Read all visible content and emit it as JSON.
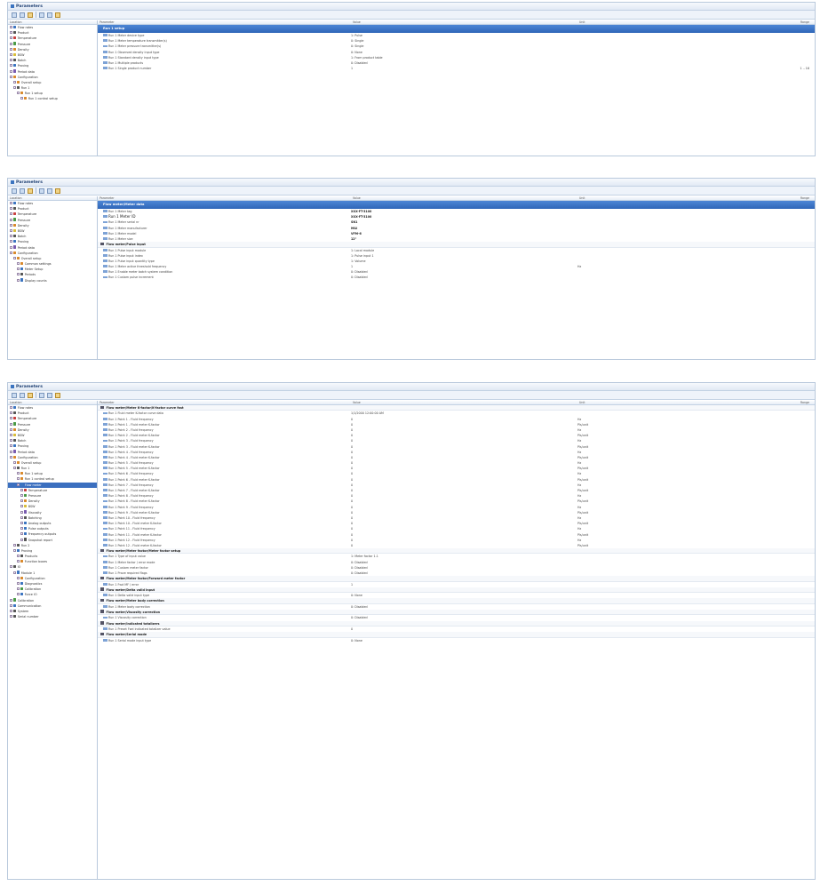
{
  "panel1": {
    "title": "Parameters",
    "tree_header": "Location",
    "columns": {
      "parameter": "Parameter",
      "value": "Value",
      "unit": "Unit",
      "range": "Range"
    },
    "section": "Run 1 setup",
    "tree": [
      {
        "label": "Flow rates",
        "icon": "ic-b"
      },
      {
        "label": "Product",
        "icon": "ic-k"
      },
      {
        "label": "Temperature",
        "icon": "ic-r"
      },
      {
        "label": "Pressure",
        "icon": "ic-g"
      },
      {
        "label": "Density",
        "icon": "ic-o"
      },
      {
        "label": "BSW",
        "icon": "ic-y"
      },
      {
        "label": "Batch",
        "icon": "ic-k"
      },
      {
        "label": "Proving",
        "icon": "ic-b"
      },
      {
        "label": "Period data",
        "icon": "ic-p"
      },
      {
        "label": "Configuration",
        "icon": "ic-o"
      },
      {
        "label": "Overall setup",
        "icon": "ic-o"
      },
      {
        "label": "Run 1",
        "icon": "ic-k"
      },
      {
        "label": "Run 1 setup",
        "icon": "ic-o"
      },
      {
        "label": "Run 1 control setup",
        "icon": "ic-o"
      }
    ],
    "rows": [
      {
        "p": "Run 1 Meter device type",
        "v": "1: Pulse",
        "u": "",
        "r": ""
      },
      {
        "p": "Run 1 Meter temperature transmitter(s)",
        "v": "0: Single",
        "u": "",
        "r": ""
      },
      {
        "p": "Run 1 Meter pressure transmitter(s)",
        "v": "0: Single",
        "u": "",
        "r": ""
      },
      {
        "p": "Run 1 Observed density input type",
        "v": "0: None",
        "u": "",
        "r": ""
      },
      {
        "p": "Run 1 Standard density input type",
        "v": "1: From product table",
        "u": "",
        "r": ""
      },
      {
        "p": "Run 1 Multiple products",
        "v": "0: Disabled",
        "u": "",
        "r": ""
      },
      {
        "p": "Run 1 Single product number",
        "v": "1",
        "u": "",
        "r": "1 .. 16"
      }
    ]
  },
  "panel2": {
    "title": "Parameters",
    "tree_header": "Location",
    "columns": {
      "parameter": "Parameter",
      "value": "Value",
      "unit": "Unit",
      "range": "Range"
    },
    "section": "Flow meter/Meter data",
    "tree": [
      {
        "label": "Flow rates",
        "icon": "ic-b"
      },
      {
        "label": "Product",
        "icon": "ic-k"
      },
      {
        "label": "Temperature",
        "icon": "ic-r"
      },
      {
        "label": "Pressure",
        "icon": "ic-g"
      },
      {
        "label": "Density",
        "icon": "ic-o"
      },
      {
        "label": "BSW",
        "icon": "ic-y"
      },
      {
        "label": "Batch",
        "icon": "ic-k"
      },
      {
        "label": "Proving",
        "icon": "ic-b"
      },
      {
        "label": "Period data",
        "icon": "ic-p"
      },
      {
        "label": "Configuration",
        "icon": "ic-o"
      },
      {
        "label": "Overall setup",
        "icon": "ic-o"
      },
      {
        "label": "Common settings",
        "icon": "ic-o"
      },
      {
        "label": "Meter Setup",
        "icon": "ic-b"
      },
      {
        "label": "Periods",
        "icon": "ic-k"
      },
      {
        "label": "Display counts",
        "icon": "ic-b"
      }
    ],
    "rows_a": [
      {
        "p": "Run 1 Meter tag",
        "v": "XXX-FT-3100",
        "u": "",
        "r": "",
        "big": false,
        "bold": true
      },
      {
        "p": "Run 1 Meter ID",
        "v": "XXX-FT-3100",
        "u": "",
        "r": "",
        "big": true,
        "bold": true
      },
      {
        "p": "Run 1 Meter serial nr",
        "v": "SN1",
        "u": "",
        "r": "",
        "big": false,
        "bold": true
      },
      {
        "p": "Run 1 Meter manufacturer",
        "v": "M&I",
        "u": "",
        "r": "",
        "big": false,
        "bold": true
      },
      {
        "p": "Run 1 Meter model",
        "v": "VFM-6",
        "u": "",
        "r": "",
        "big": false,
        "bold": true
      },
      {
        "p": "Run 1 Meter size",
        "v": "12\"",
        "u": "",
        "r": "",
        "big": false,
        "bold": true
      }
    ],
    "section2": "Flow meter/Pulse input",
    "rows_b": [
      {
        "p": "Run 1 Pulse input module",
        "v": "1: Local module",
        "u": "",
        "r": ""
      },
      {
        "p": "Run 1 Pulse input index",
        "v": "1: Pulse input 1",
        "u": "",
        "r": ""
      },
      {
        "p": "Run 1 Pulse input quantity type",
        "v": "1: Volume",
        "u": "",
        "r": ""
      },
      {
        "p": "Run 1 Meter active threshold frequency",
        "v": "1",
        "u": "Hz",
        "r": ""
      },
      {
        "p": "Run 1 Enable meter batch system condition",
        "v": "0: Disabled",
        "u": "",
        "r": ""
      },
      {
        "p": "Run 1 Custom pulse increment",
        "v": "0: Disabled",
        "u": "",
        "r": ""
      }
    ]
  },
  "panel3": {
    "title": "Parameters",
    "tree_header": "Location",
    "columns": {
      "parameter": "Parameter",
      "value": "Value",
      "unit": "Unit",
      "range": "Range"
    },
    "tree": [
      {
        "label": "Flow rates",
        "icon": "ic-b"
      },
      {
        "label": "Product",
        "icon": "ic-k"
      },
      {
        "label": "Temperature",
        "icon": "ic-r"
      },
      {
        "label": "Pressure",
        "icon": "ic-g"
      },
      {
        "label": "Density",
        "icon": "ic-o"
      },
      {
        "label": "BSW",
        "icon": "ic-y"
      },
      {
        "label": "Batch",
        "icon": "ic-k"
      },
      {
        "label": "Proving",
        "icon": "ic-b"
      },
      {
        "label": "Period data",
        "icon": "ic-p"
      },
      {
        "label": "Configuration",
        "icon": "ic-o"
      },
      {
        "label": "Overall setup",
        "icon": "ic-o"
      },
      {
        "label": "Run 1",
        "icon": "ic-k"
      },
      {
        "label": "Run 1 setup",
        "icon": "ic-o"
      },
      {
        "label": "Run 1 control setup",
        "icon": "ic-o"
      },
      {
        "label": "Flow meter",
        "icon": "ic-b",
        "selected": true
      },
      {
        "label": "Temperature",
        "icon": "ic-r"
      },
      {
        "label": "Pressure",
        "icon": "ic-g"
      },
      {
        "label": "Density",
        "icon": "ic-o"
      },
      {
        "label": "BSW",
        "icon": "ic-y"
      },
      {
        "label": "Viscosity",
        "icon": "ic-p"
      },
      {
        "label": "Batching",
        "icon": "ic-k"
      },
      {
        "label": "Analog outputs",
        "icon": "ic-b"
      },
      {
        "label": "Pulse outputs",
        "icon": "ic-b"
      },
      {
        "label": "Frequency outputs",
        "icon": "ic-b"
      },
      {
        "label": "Snapshot report",
        "icon": "ic-k"
      },
      {
        "label": "Run 2",
        "icon": "ic-k"
      },
      {
        "label": "Proving",
        "icon": "ic-b"
      },
      {
        "label": "Products",
        "icon": "ic-k"
      },
      {
        "label": "Function boxes",
        "icon": "ic-o"
      },
      {
        "label": "IO",
        "icon": "ic-k"
      },
      {
        "label": "Module 1",
        "icon": "ic-b"
      },
      {
        "label": "Configuration",
        "icon": "ic-o"
      },
      {
        "label": "Diagnostics",
        "icon": "ic-b"
      },
      {
        "label": "Calibration",
        "icon": "ic-g"
      },
      {
        "label": "Force IO",
        "icon": "ic-b"
      },
      {
        "label": "Calibration",
        "icon": "ic-g"
      },
      {
        "label": "Communication",
        "icon": "ic-b"
      },
      {
        "label": "System",
        "icon": "ic-k"
      },
      {
        "label": "Serial number",
        "icon": "ic-k"
      }
    ],
    "sec_kfactor": "Flow meter/Meter K-factor/K-factor curve fast",
    "kf_first": {
      "p": "Run 1 Fluid meter K-factor curve data",
      "v": "1/1/2000 12:00:00 AM",
      "u": "",
      "r": ""
    },
    "kf_points": [
      {
        "n": "1"
      },
      {
        "n": "2"
      },
      {
        "n": "3"
      },
      {
        "n": "4"
      },
      {
        "n": "5"
      },
      {
        "n": "6"
      },
      {
        "n": "7"
      },
      {
        "n": "8"
      },
      {
        "n": "9"
      },
      {
        "n": "10"
      },
      {
        "n": "11"
      },
      {
        "n": "12"
      }
    ],
    "kf_freq_label": "Fluid frequency",
    "kf_kf_label": "Fluid meter K-factor",
    "kf_value": "0",
    "unit_hz": "Hz",
    "unit_pm3": "Pls/unit",
    "sec_mf": "Flow meter/Meter factor/Meter factor setup",
    "rows_mf": [
      {
        "p": "Run 1 Type of input value",
        "v": "1: Meter factor 1.1",
        "u": "",
        "r": ""
      },
      {
        "p": "Run 1 Meter factor / error mode",
        "v": "0: Disabled",
        "u": "",
        "r": ""
      },
      {
        "p": "Run 1 Custom meter factor",
        "v": "0: Disabled",
        "u": "",
        "r": ""
      },
      {
        "p": "Run 1 Prove required flags",
        "v": "0: Disabled",
        "u": "",
        "r": ""
      }
    ],
    "sec_fwd": "Flow meter/Meter factor/Forward meter factor",
    "rows_fwd": [
      {
        "p": "Run 1 Fwd MF / error",
        "v": "1",
        "u": "",
        "r": ""
      }
    ],
    "sec_delta": "Flow meter/Delta valid input",
    "rows_delta": [
      {
        "p": "Run 1 Delta valid input type",
        "v": "0: None",
        "u": "",
        "r": ""
      }
    ],
    "sec_body": "Flow meter/Meter body correction",
    "rows_body": [
      {
        "p": "Run 1 Meter body correction",
        "v": "0: Disabled",
        "u": "",
        "r": ""
      }
    ],
    "sec_visc": "Flow meter/Viscosity correction",
    "rows_visc": [
      {
        "p": "Run 1 Viscosity correction",
        "v": "0: Disabled",
        "u": "",
        "r": ""
      }
    ],
    "sec_ind": "Flow meter/Indicated totalizers",
    "rows_ind": [
      {
        "p": "Run 1 Preset Fwd indicated totalizer value",
        "v": "0",
        "u": "",
        "r": ""
      }
    ],
    "sec_serial": "Flow meter/Serial mode",
    "rows_serial": [
      {
        "p": "Run 1 Serial mode input type",
        "v": "0: None",
        "u": "",
        "r": ""
      }
    ]
  }
}
